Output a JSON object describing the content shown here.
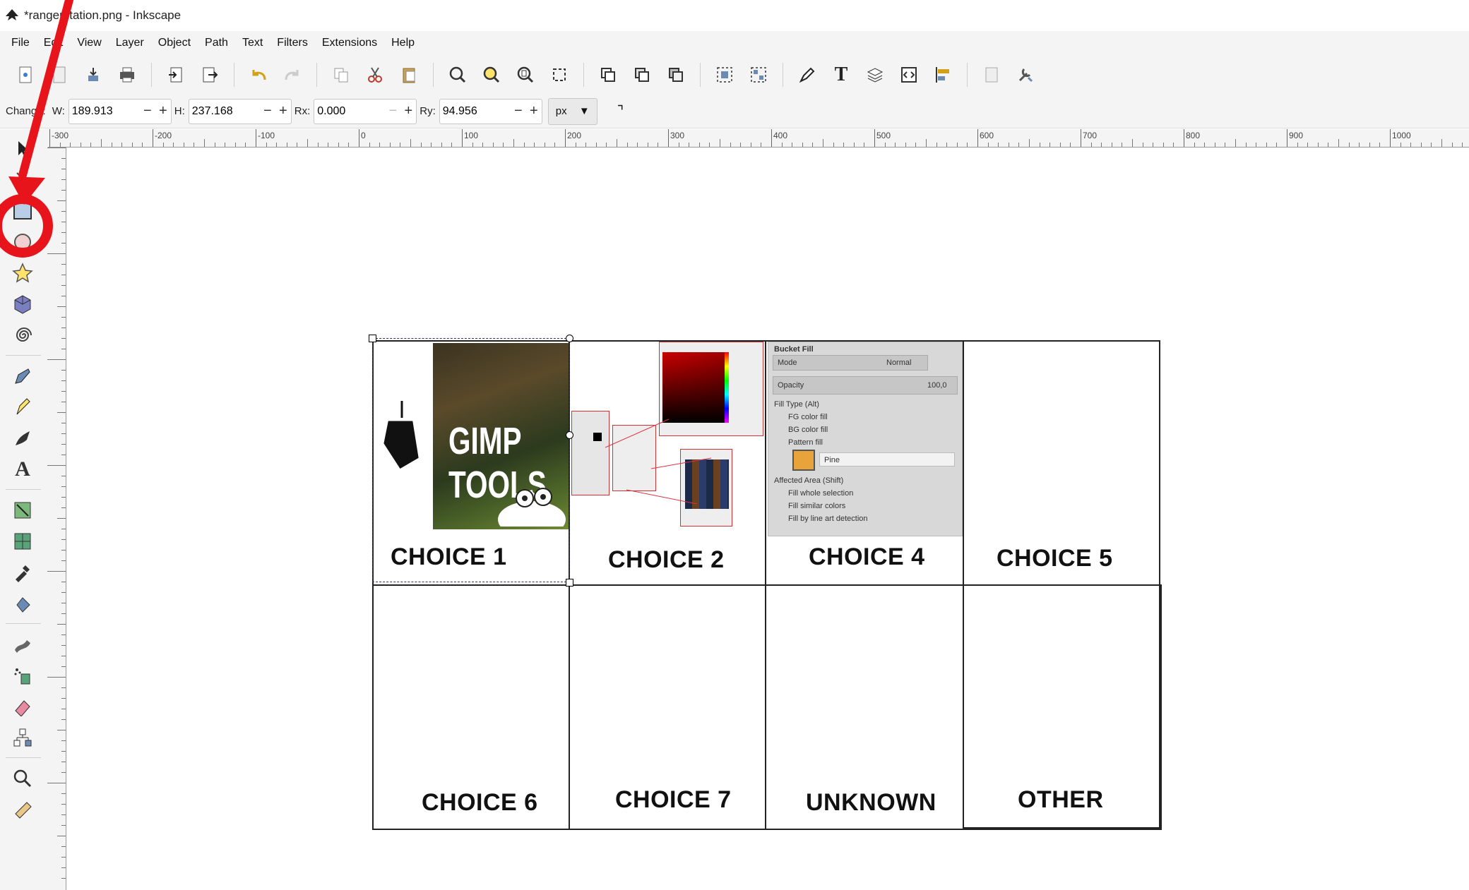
{
  "window": {
    "title": "*rangerstation.png - Inkscape"
  },
  "menu": [
    "File",
    "Edit",
    "View",
    "Layer",
    "Object",
    "Path",
    "Text",
    "Filters",
    "Extensions",
    "Help"
  ],
  "toolcontrols": {
    "label": "Change:",
    "w_label": "W:",
    "w_value": "189.913",
    "h_label": "H:",
    "h_value": "237.168",
    "rx_label": "Rx:",
    "rx_value": "0.000",
    "ry_label": "Ry:",
    "ry_value": "94.956",
    "unit": "px"
  },
  "ruler": {
    "labels": [
      "-300",
      "-200",
      "-100",
      "0",
      "100",
      "200",
      "300",
      "400",
      "500",
      "600",
      "700",
      "800",
      "900",
      "1000"
    ]
  },
  "canvas": {
    "image_title": "GIMP TOOLS",
    "bucket_fill": {
      "title": "Bucket Fill",
      "mode_label": "Mode",
      "mode_value": "Normal",
      "opacity_label": "Opacity",
      "opacity_value": "100,0",
      "fill_type": "Fill Type  (Alt)",
      "fg": "FG color fill",
      "bg": "BG color fill",
      "pattern": "Pattern fill",
      "pattern_name": "Pine",
      "affected": "Affected Area  (Shift)",
      "whole": "Fill whole selection",
      "similar": "Fill similar colors",
      "lineart": "Fill by line art detection"
    },
    "cells": [
      "CHOICE 1",
      "CHOICE 2",
      "CHOICE 4",
      "CHOICE 5",
      "CHOICE 6",
      "CHOICE 7",
      "UNKNOWN",
      "OTHER"
    ]
  },
  "colors": {
    "annotation": "#e8141b",
    "chrome": "#f4f4f4"
  }
}
